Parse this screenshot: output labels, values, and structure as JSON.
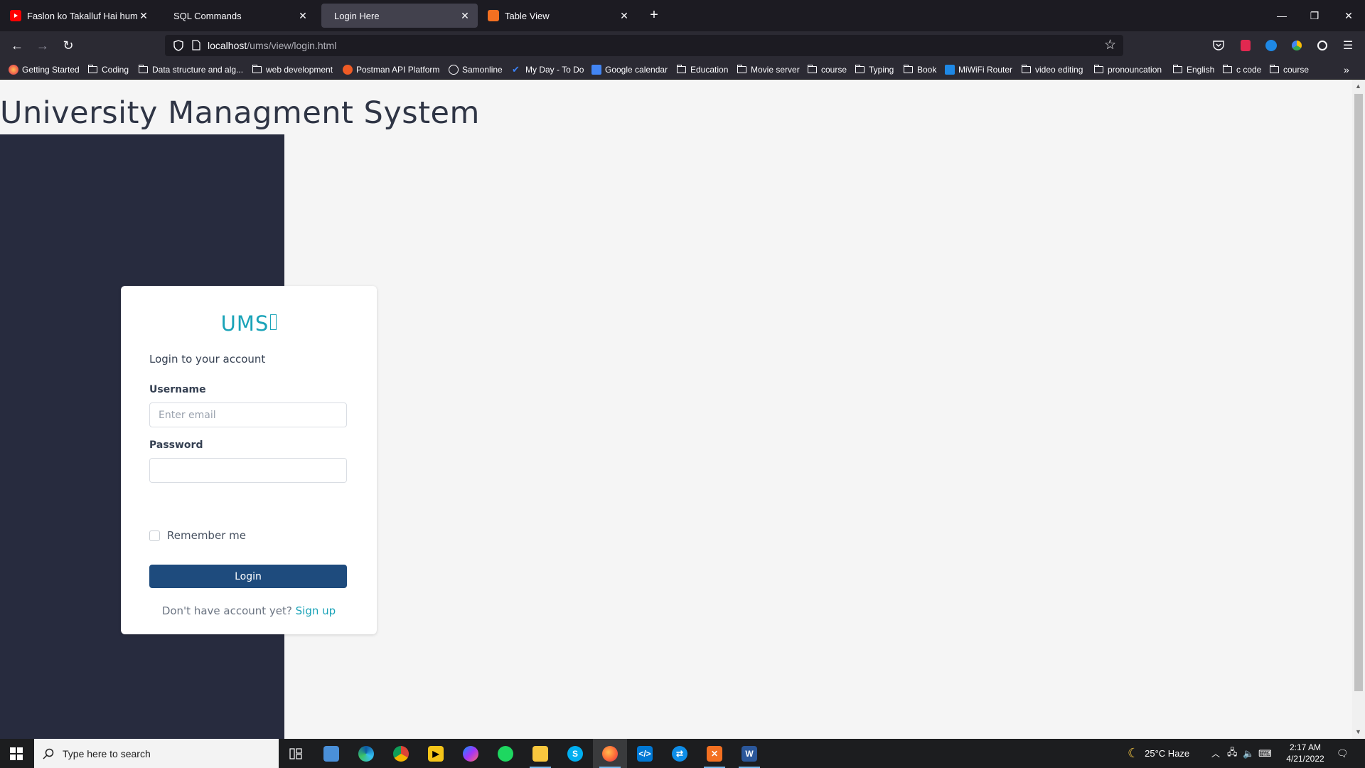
{
  "browser": {
    "tabs": [
      {
        "title": "Faslon ko Takalluf Hai humse A",
        "icon_color": "#ff0000",
        "active": false
      },
      {
        "title": "SQL Commands",
        "icon_color": "",
        "active": false
      },
      {
        "title": "Login Here",
        "icon_color": "",
        "active": true
      },
      {
        "title": "Table View",
        "icon_color": "#f37021",
        "active": false
      }
    ],
    "new_tab": "+",
    "url_host": "localhost",
    "url_path": "/ums/view/login.html",
    "bookmarks": [
      {
        "label": "Getting Started",
        "icon": "firefox-icon"
      },
      {
        "label": "Coding",
        "icon": "folder-icon"
      },
      {
        "label": "Data structure and alg...",
        "icon": "folder-icon"
      },
      {
        "label": "web development",
        "icon": "folder-icon"
      },
      {
        "label": "Postman API Platform",
        "icon": "postman-icon"
      },
      {
        "label": "Samonline",
        "icon": "globe-icon"
      },
      {
        "label": "My Day - To Do",
        "icon": "todo-icon"
      },
      {
        "label": "Google calendar",
        "icon": "calendar-icon"
      },
      {
        "label": "Education",
        "icon": "folder-icon"
      },
      {
        "label": "Movie server",
        "icon": "folder-icon"
      },
      {
        "label": "course",
        "icon": "folder-icon"
      },
      {
        "label": "Typing",
        "icon": "folder-icon"
      },
      {
        "label": "Book",
        "icon": "folder-icon"
      },
      {
        "label": "MiWiFi Router",
        "icon": "wifi-icon"
      },
      {
        "label": "video editing",
        "icon": "folder-icon"
      },
      {
        "label": "pronouncation",
        "icon": "folder-icon"
      },
      {
        "label": "English",
        "icon": "folder-icon"
      },
      {
        "label": "c code",
        "icon": "folder-icon"
      },
      {
        "label": "course",
        "icon": "folder-icon"
      }
    ]
  },
  "page": {
    "title": "University Managment System",
    "brand": "UMS",
    "subtitle": "Login to your account",
    "username_label": "Username",
    "username_placeholder": "Enter email",
    "password_label": "Password",
    "remember_label": "Remember me",
    "login_button": "Login",
    "signup_prompt": "Don't have account yet?",
    "signup_link": "Sign up"
  },
  "taskbar": {
    "search_placeholder": "Type here to search",
    "weather": "25°C  Haze",
    "time": "2:17 AM",
    "date": "4/21/2022"
  },
  "colors": {
    "accent": "#1aa3b8",
    "button": "#1e4b7d",
    "sidebar": "#272b3e"
  }
}
